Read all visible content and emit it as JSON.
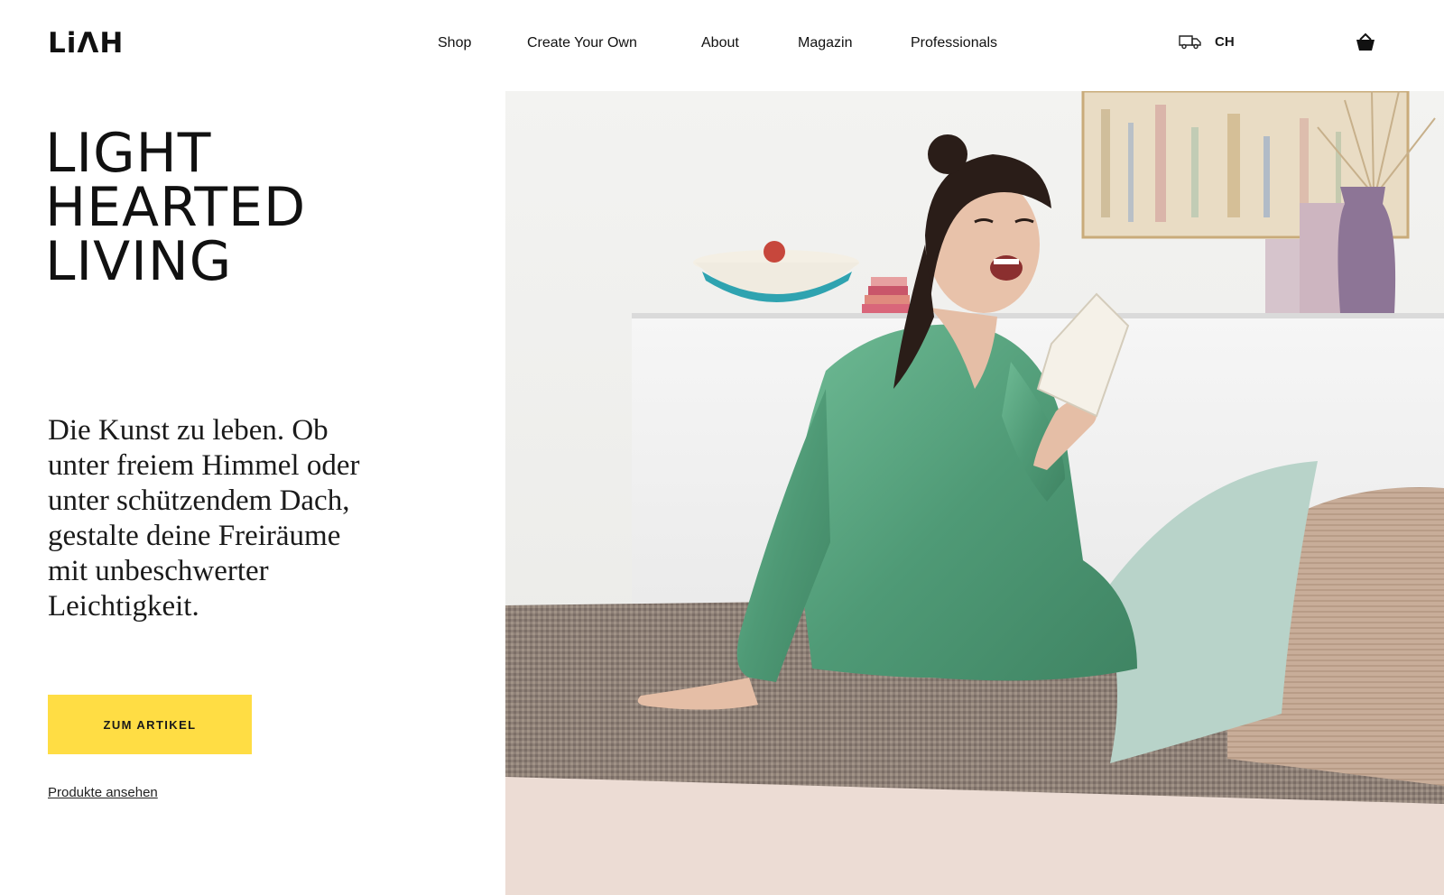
{
  "brand": {
    "logo_text": "LiΛH"
  },
  "nav": {
    "items": [
      {
        "label": "Shop"
      },
      {
        "label": "Create Your Own"
      },
      {
        "label": "About"
      },
      {
        "label": "Magazin"
      },
      {
        "label": "Professionals"
      }
    ]
  },
  "header": {
    "delivery_icon": "truck-icon",
    "region_code": "CH",
    "cart_icon": "basket-icon"
  },
  "hero": {
    "headline_lines": [
      "LIGHT",
      "HEARTED",
      "LIVING"
    ],
    "lead": "Die Kunst zu leben. Ob unter freiem Himmel oder unter schützendem Dach, gestalte deine Freiräume mit unbeschwerter Leichtigkeit.",
    "cta_label": "ZUM ARTIKEL",
    "secondary_link": "Produkte ansehen"
  },
  "colors": {
    "accent": "#ffdd44",
    "text": "#111111",
    "dress": "#5aa882"
  }
}
